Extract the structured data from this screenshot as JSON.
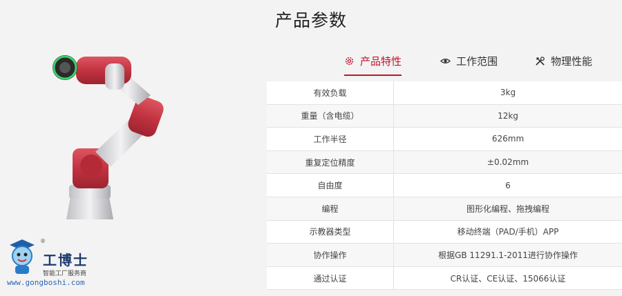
{
  "page": {
    "title": "产品参数"
  },
  "logo": {
    "brand": "工博士",
    "registered": "®",
    "slogan": "智能工厂服务商",
    "url": "www.gongboshi.com"
  },
  "tabs": [
    {
      "label": "产品特性",
      "icon": "gear-icon",
      "active": true
    },
    {
      "label": "工作范围",
      "icon": "eye-icon",
      "active": false
    },
    {
      "label": "物理性能",
      "icon": "tools-icon",
      "active": false
    }
  ],
  "specs": [
    {
      "name": "有效负载",
      "value": "3kg"
    },
    {
      "name": "重量（含电缆）",
      "value": "12kg"
    },
    {
      "name": "工作半径",
      "value": "626mm"
    },
    {
      "name": "重复定位精度",
      "value": "±0.02mm"
    },
    {
      "name": "自由度",
      "value": "6"
    },
    {
      "name": "编程",
      "value": "图形化编程、拖拽编程"
    },
    {
      "name": "示教器类型",
      "value": "移动终端（PAD/手机）APP"
    },
    {
      "name": "协作操作",
      "value": "根据GB 11291.1-2011进行协作操作"
    },
    {
      "name": "通过认证",
      "value": "CR认证、CE认证、15066认证"
    }
  ],
  "colors": {
    "accent": "#c3122e",
    "robot_red": "#c8323f",
    "robot_silver": "#d9d9dc"
  }
}
